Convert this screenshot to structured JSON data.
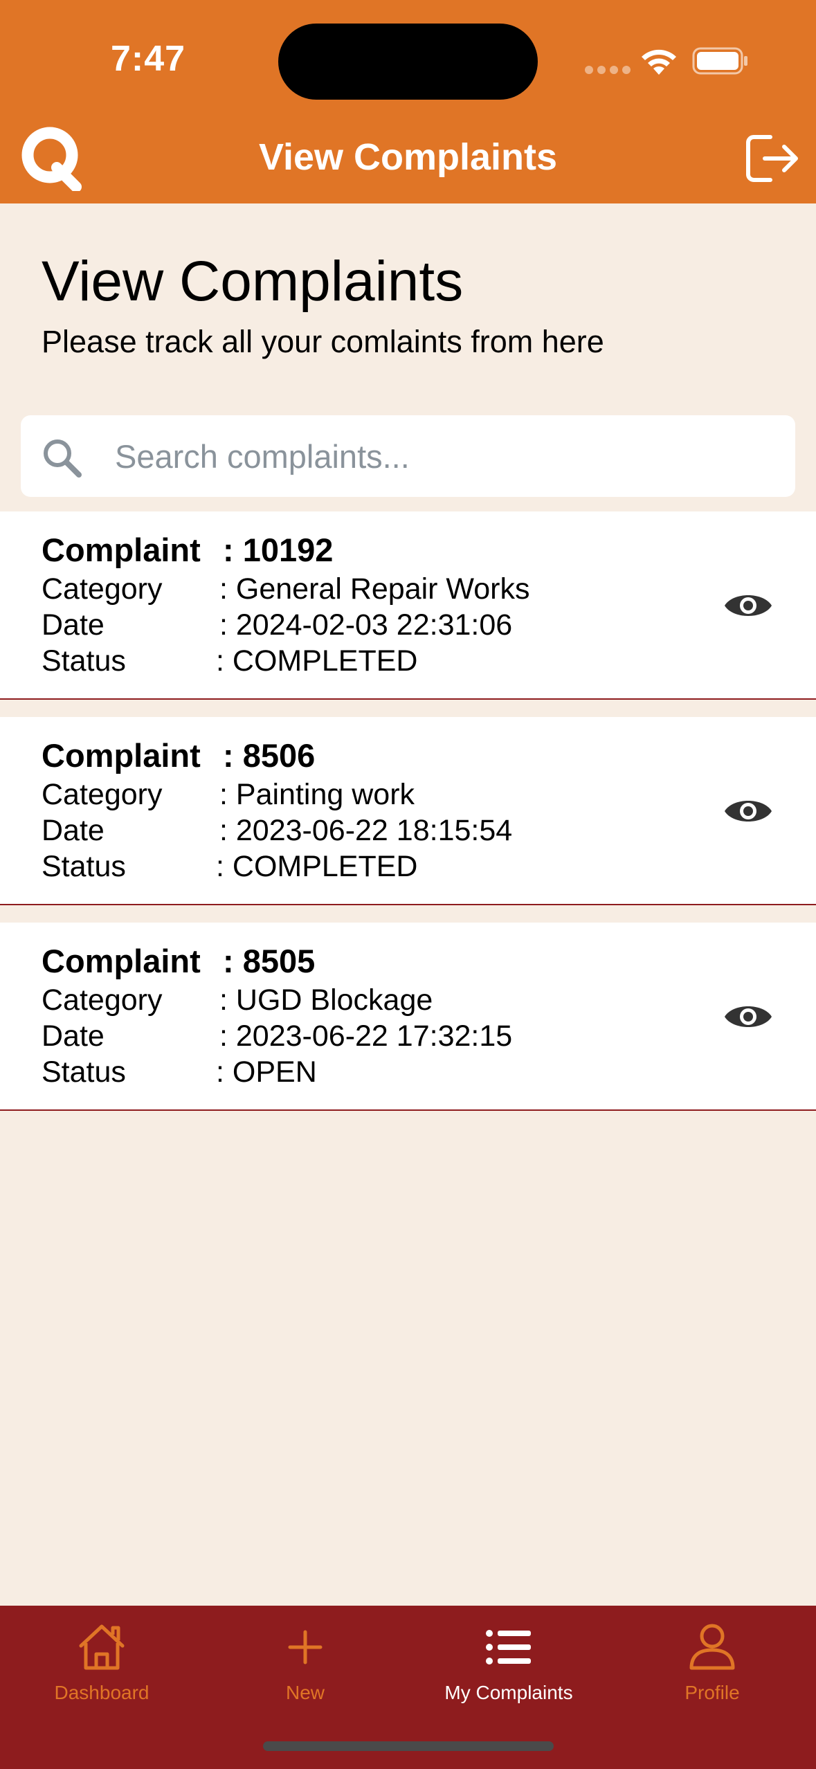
{
  "status_bar": {
    "time": "7:47"
  },
  "header": {
    "title": "View Complaints"
  },
  "page": {
    "title": "View Complaints",
    "subtitle": "Please track all your comlaints from here"
  },
  "search": {
    "placeholder": "Search complaints...",
    "value": ""
  },
  "labels": {
    "complaint": "Complaint",
    "category": "Category",
    "date": "Date",
    "status": "Status"
  },
  "complaints": [
    {
      "id": ": 10192",
      "category": ": General Repair Works",
      "date": ": 2024-02-03 22:31:06",
      "status": ": COMPLETED"
    },
    {
      "id": ": 8506",
      "category": ": Painting work",
      "date": ": 2023-06-22 18:15:54",
      "status": ": COMPLETED"
    },
    {
      "id": ": 8505",
      "category": ": UGD Blockage",
      "date": ": 2023-06-22 17:32:15",
      "status": ": OPEN"
    }
  ],
  "tabs": [
    {
      "label": "Dashboard",
      "icon": "home-icon",
      "active": false
    },
    {
      "label": "New",
      "icon": "plus-icon",
      "active": false
    },
    {
      "label": "My Complaints",
      "icon": "list-icon",
      "active": true
    },
    {
      "label": "Profile",
      "icon": "user-icon",
      "active": false
    }
  ],
  "colors": {
    "brand_orange": "#e07526",
    "tabbar_maroon": "#8e1c1e",
    "background": "#f7ede3"
  }
}
